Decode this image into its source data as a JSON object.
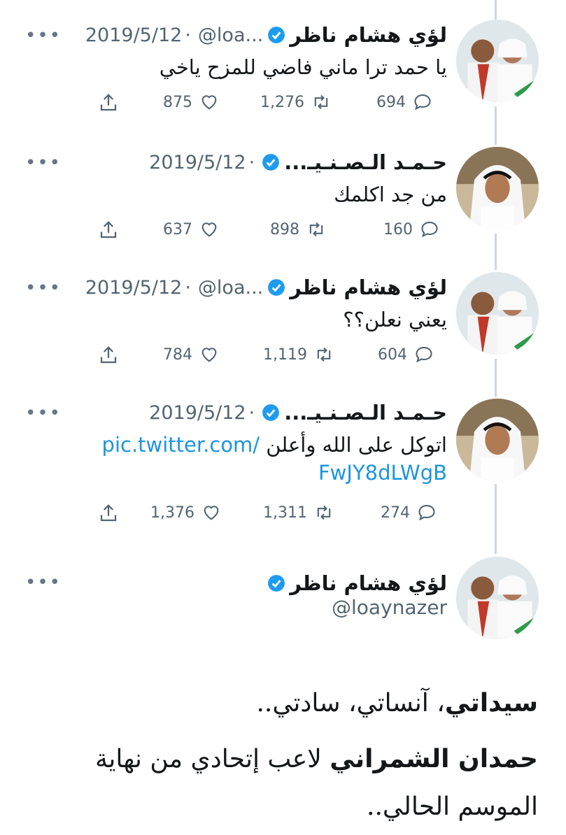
{
  "tweets": [
    {
      "name": "لؤي هشام ناظر",
      "handle": "@loa...",
      "date": "2019/5/12",
      "text": "يا حمد ترا ماني فاضي للمزح ياخي",
      "likes": "875",
      "retweets": "1,276",
      "replies": "694"
    },
    {
      "name": "حـمـد الـصـنـيـ...",
      "date": "2019/5/12",
      "text": "من جد اكلمك",
      "likes": "637",
      "retweets": "898",
      "replies": "160"
    },
    {
      "name": "لؤي هشام ناظر",
      "handle": "@loa...",
      "date": "2019/5/12",
      "text": "يعني نعلن؟؟",
      "likes": "784",
      "retweets": "1,119",
      "replies": "604"
    },
    {
      "name": "حـمـد الـصـنـيـ...",
      "date": "2019/5/12",
      "text": "اتوكل على الله وأعلن",
      "link1": "pic.twitter.com/",
      "link2": "FwJY8dLWgB",
      "likes": "1,376",
      "retweets": "1,311",
      "replies": "274"
    }
  ],
  "final_tweet": {
    "name": "لؤي هشام ناظر",
    "handle": "@loaynazer",
    "line1_bold": "سيداتي",
    "line1_rest": "، آنساتي، سادتي..",
    "line2_bold": "حمدان الشمراني",
    "line2_rest": " لاعب إتحادي من نهاية",
    "line3": "الموسم الحالي.."
  },
  "colors": {
    "verified": "#1d9bf0",
    "link": "#1b95e0",
    "muted": "#536471",
    "thread_line": "#ccd6dd"
  },
  "icons": [
    "verified-icon",
    "more-icon",
    "reply-icon",
    "retweet-icon",
    "like-icon",
    "share-icon"
  ]
}
